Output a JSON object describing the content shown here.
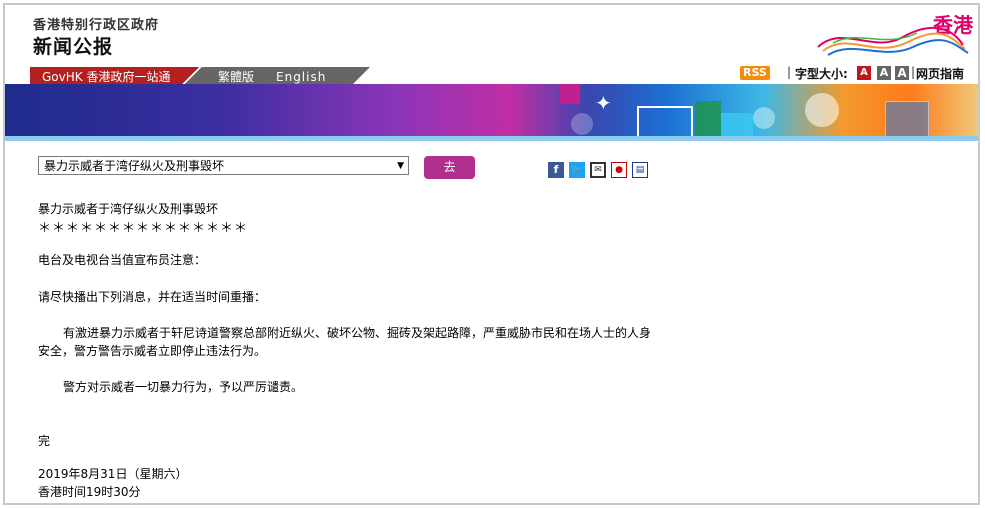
{
  "header": {
    "gov_name": "香港特别行政区政府",
    "press_title": "新闻公报",
    "brand_logo": "香港",
    "tabs": {
      "gov": "GovHK 香港政府一站通",
      "traditional": "繁體版",
      "english": "English"
    },
    "tools": {
      "rss": "RSS",
      "font_size_label": "字型大小:",
      "font_small": "A",
      "font_medium": "A",
      "font_large": "A",
      "web_guide": "网页指南"
    }
  },
  "nav": {
    "select_value": "暴力示威者于湾仔纵火及刑事毁坏",
    "go_button": "去",
    "share_icons": [
      "facebook-icon",
      "twitter-icon",
      "email-icon",
      "weibo-icon",
      "print-icon"
    ]
  },
  "article": {
    "title": "暴力示威者于湾仔纵火及刑事毁坏",
    "stars": "＊＊＊＊＊＊＊＊＊＊＊＊＊＊＊",
    "line1": "电台及电视台当值宣布员注意：",
    "line2": "请尽快播出下列消息，并在适当时间重播：",
    "para1_line1": "有激进暴力示威者于轩尼诗道警察总部附近纵火、破坏公物、掘砖及架起路障，严重威胁市民和在场人士的人身",
    "para1_line2": "安全，警方警告示威者立即停止违法行为。",
    "para2": "警方对示威者一切暴力行为，予以严厉谴责。",
    "end": "完",
    "date": "2019年8月31日（星期六）",
    "time": "香港时间19时30分"
  },
  "colors": {
    "gov_tab": "#b41f1f",
    "lang_tab": "#666666",
    "go_button": "#b0308f",
    "logo": "#e00068",
    "rss": "#f28c0b"
  }
}
